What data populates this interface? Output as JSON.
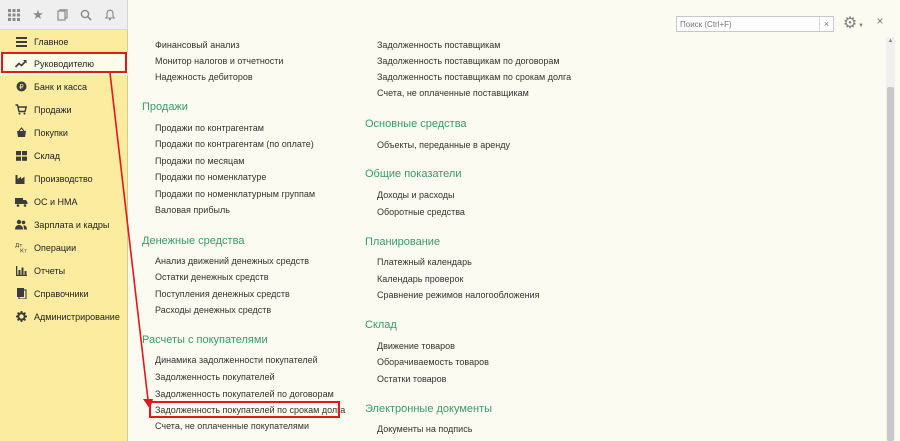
{
  "toolbar": {
    "icons": [
      "apps-grid-icon",
      "star-icon",
      "history-icon",
      "search-icon",
      "bell-icon"
    ]
  },
  "sidebar": {
    "items": [
      {
        "label": "Главное",
        "icon": "menu-lines-icon"
      },
      {
        "label": "Руководителю",
        "icon": "trend-up-icon",
        "active": true
      },
      {
        "label": "Банк и касса",
        "icon": "coin-icon"
      },
      {
        "label": "Продажи",
        "icon": "cart-icon"
      },
      {
        "label": "Покупки",
        "icon": "basket-icon"
      },
      {
        "label": "Склад",
        "icon": "grid-icon"
      },
      {
        "label": "Производство",
        "icon": "factory-icon"
      },
      {
        "label": "ОС и НМА",
        "icon": "truck-icon"
      },
      {
        "label": "Зарплата и кадры",
        "icon": "people-icon"
      },
      {
        "label": "Операции",
        "icon": "dt-kt-icon"
      },
      {
        "label": "Отчеты",
        "icon": "bar-chart-icon"
      },
      {
        "label": "Справочники",
        "icon": "book-icon"
      },
      {
        "label": "Администрирование",
        "icon": "gear-icon"
      }
    ]
  },
  "search": {
    "placeholder": "Поиск (Ctrl+F)",
    "clear": "×"
  },
  "content": {
    "left_top_links": [
      "Финансовый анализ",
      "Монитор налогов и отчетности",
      "Надежность дебиторов"
    ],
    "sales": {
      "title": "Продажи",
      "links": [
        "Продажи по контрагентам",
        "Продажи по контрагентам (по оплате)",
        "Продажи по месяцам",
        "Продажи по номенклатуре",
        "Продажи по номенклатурным группам",
        "Валовая прибыль"
      ]
    },
    "cash": {
      "title": "Денежные средства",
      "links": [
        "Анализ движений денежных средств",
        "Остатки денежных средств",
        "Поступления денежных средств",
        "Расходы денежных средств"
      ]
    },
    "customers": {
      "title": "Расчеты с покупателями",
      "links": [
        "Динамика задолженности покупателей",
        "Задолженность покупателей",
        "Задолженность покупателей по договорам",
        "Задолженность покупателей по срокам долга",
        "Счета, не оплаченные покупателями"
      ]
    },
    "right_top_links": [
      "Задолженность поставщикам",
      "Задолженность поставщикам по договорам",
      "Задолженность поставщикам по срокам долга",
      "Счета, не оплаченные поставщикам"
    ],
    "fixed_assets": {
      "title": "Основные средства",
      "links": [
        "Объекты, переданные в аренду"
      ]
    },
    "general": {
      "title": "Общие показатели",
      "links": [
        "Доходы и расходы",
        "Оборотные средства"
      ]
    },
    "planning": {
      "title": "Планирование",
      "links": [
        "Платежный календарь",
        "Календарь проверок",
        "Сравнение режимов налогообложения"
      ]
    },
    "warehouse": {
      "title": "Склад",
      "links": [
        "Движение товаров",
        "Оборачиваемость товаров",
        "Остатки товаров"
      ]
    },
    "edocs": {
      "title": "Электронные документы",
      "links": [
        "Документы на подпись"
      ]
    }
  },
  "colors": {
    "accent": "#3a9a66",
    "sidebar_bg": "#fbeca0",
    "highlight": "#e0191b"
  }
}
